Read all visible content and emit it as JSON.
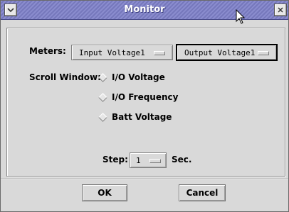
{
  "window": {
    "title": "Monitor",
    "menu_icon": "chevron-down-icon",
    "close_icon": "close-icon"
  },
  "meters": {
    "label": "Meters:",
    "menu1_value": "Input Voltage1",
    "menu2_value": "Output Voltage1"
  },
  "scroll_window": {
    "label": "Scroll Window:",
    "options": [
      {
        "label": "I/O Voltage"
      },
      {
        "label": "I/O Frequency"
      },
      {
        "label": "Batt Voltage"
      }
    ]
  },
  "step": {
    "label": "Step:",
    "value": "1",
    "unit": "Sec."
  },
  "buttons": {
    "ok": "OK",
    "cancel": "Cancel"
  },
  "colors": {
    "titlebar": "#7d7fc8",
    "window_bg": "#d9d9d9"
  }
}
